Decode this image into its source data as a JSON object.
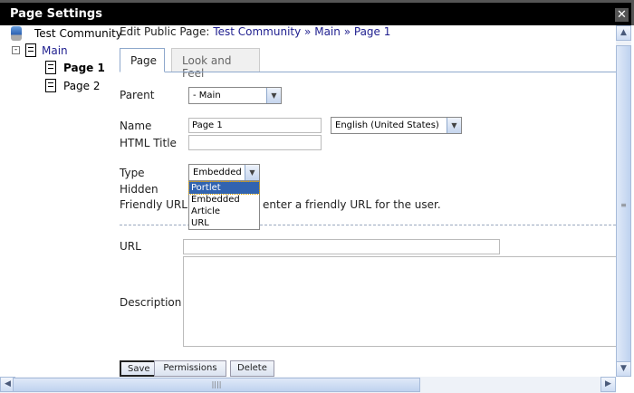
{
  "dialog": {
    "title": "Page Settings",
    "close_icon": "close-icon"
  },
  "tree": {
    "root": "Test Community",
    "items": [
      {
        "label": "Main"
      },
      {
        "label": "Page 1",
        "selected": true
      },
      {
        "label": "Page 2"
      }
    ]
  },
  "breadcrumb": {
    "prefix": "Edit Public Page:",
    "parts": [
      "Test Community",
      "Main",
      "Page 1"
    ],
    "sep": "»"
  },
  "tabs": [
    {
      "label": "Page",
      "active": true
    },
    {
      "label": "Look and Feel",
      "active": false
    }
  ],
  "form": {
    "parent_label": "Parent",
    "parent_value": "- Main",
    "name_label": "Name",
    "name_value": "Page 1",
    "language_value": "English (United States)",
    "html_title_label": "HTML Title",
    "html_title_value": "",
    "type_label": "Type",
    "type_value": "Embedded",
    "type_options": [
      "Portlet",
      "Embedded",
      "Article",
      "URL"
    ],
    "type_highlighted": "Portlet",
    "hidden_label": "Hidden",
    "friendly_url_label": "Friendly URL",
    "friendly_url_hint": "enter a friendly URL for the user.",
    "url_label": "URL",
    "url_value": "",
    "description_label": "Description",
    "description_value": ""
  },
  "buttons": {
    "save": "Save",
    "permissions": "Permissions",
    "delete": "Delete"
  }
}
